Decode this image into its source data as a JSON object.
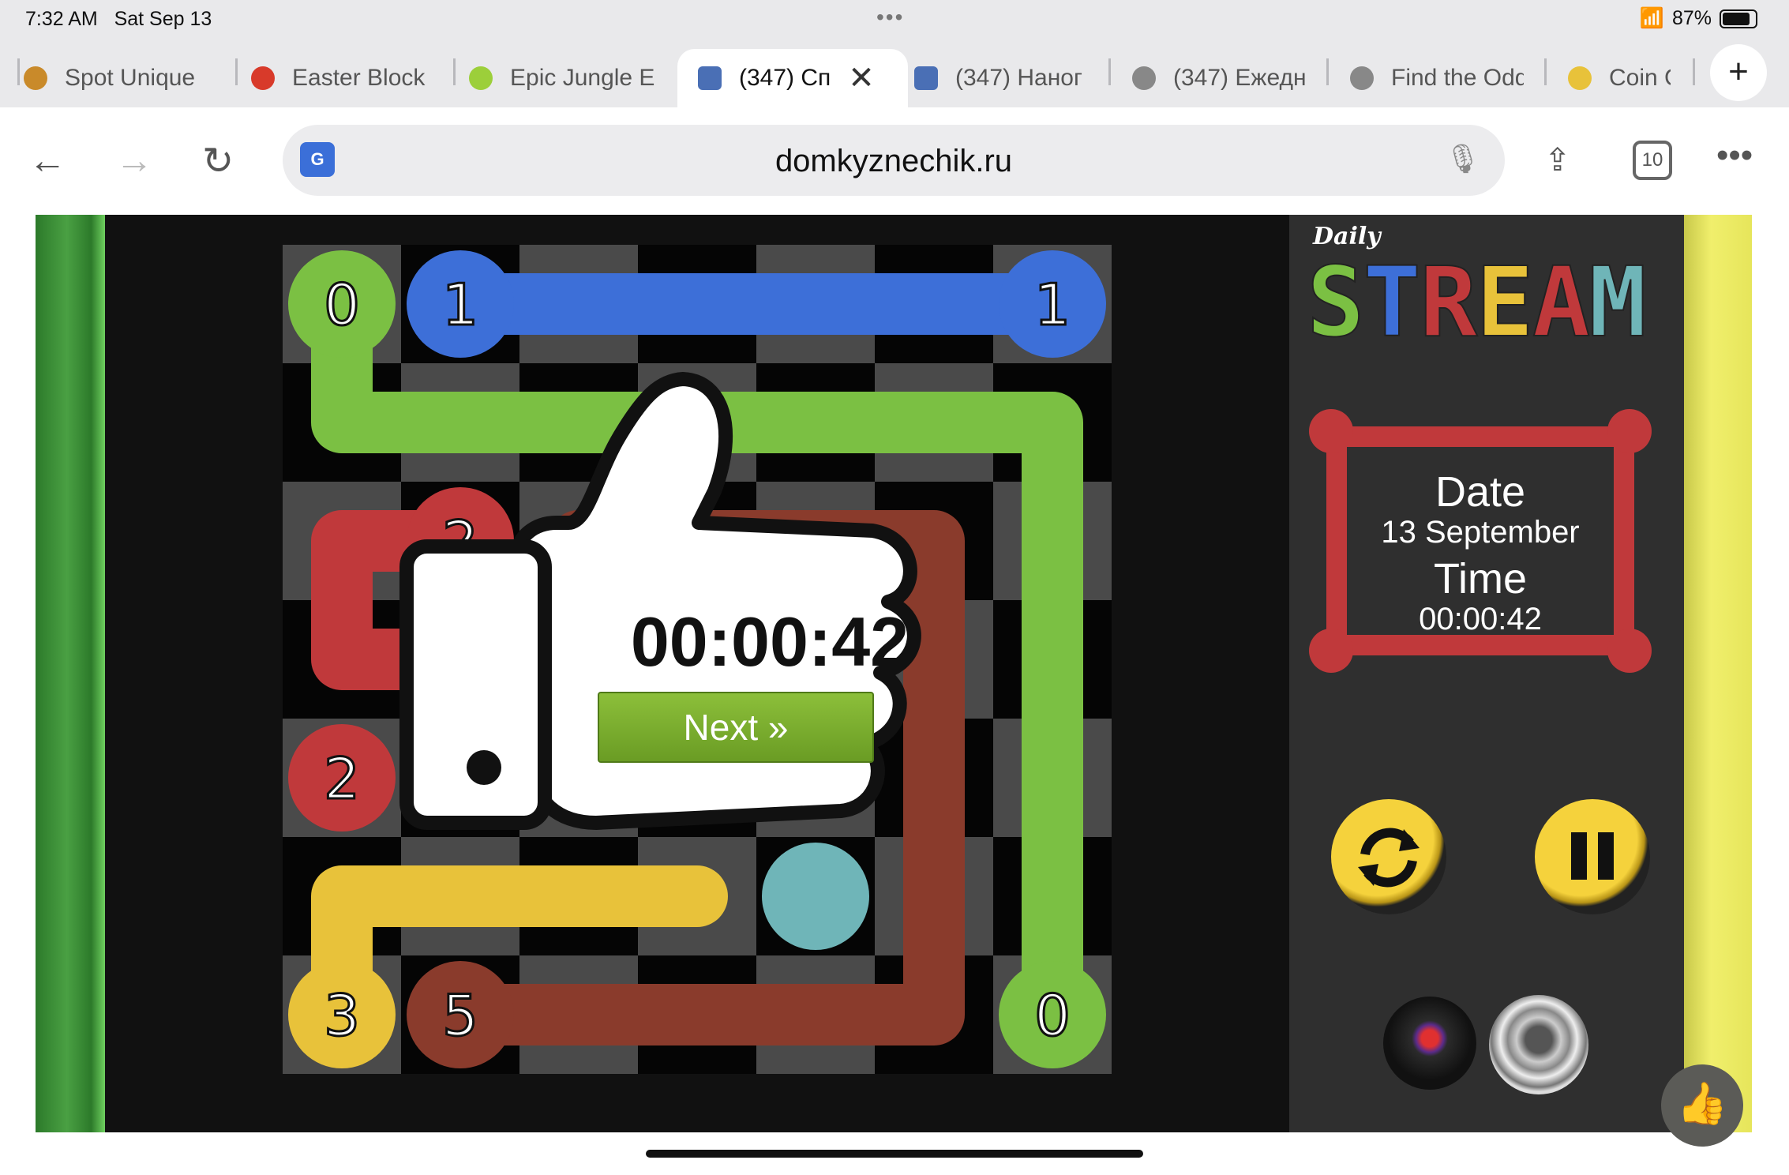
{
  "status_bar": {
    "time": "7:32 AM",
    "date": "Sat Sep 13",
    "dots": "•••",
    "battery": "87%"
  },
  "tabs": [
    {
      "label": "Spot Unique",
      "favicon_color": "#c98a2a"
    },
    {
      "label": "Easter Block",
      "favicon_color": "#d83a2a"
    },
    {
      "label": "Epic Jungle E",
      "favicon_color": "#9ccf3a"
    },
    {
      "label": "(347) Сп",
      "favicon_color": "#4a6fb5",
      "active": true
    },
    {
      "label": "(347) Наног",
      "favicon_color": "#4a6fb5"
    },
    {
      "label": "(347) Ежедн",
      "favicon_color": "#888888"
    },
    {
      "label": "Find the Odd",
      "favicon_color": "#888888"
    },
    {
      "label": "Coin C",
      "favicon_color": "#e8c23a"
    }
  ],
  "toolbar": {
    "url": "domkyznechik.ru",
    "tab_count": "10",
    "new_tab": "+",
    "close_tab": "✕",
    "translate_icon": "G"
  },
  "game": {
    "logo_daily": "Daily",
    "logo_letters": [
      {
        "ch": "S",
        "color": "#7bc043"
      },
      {
        "ch": "T",
        "color": "#3d6fd8"
      },
      {
        "ch": "R",
        "color": "#c0393b"
      },
      {
        "ch": "E",
        "color": "#e8c23a"
      },
      {
        "ch": "A",
        "color": "#c0393b"
      },
      {
        "ch": "M",
        "color": "#6fb5b8"
      }
    ],
    "date_label": "Date",
    "date_value": "13 September",
    "time_label": "Time",
    "time_value": "00:00:42",
    "popup_time": "00:00:42",
    "next_label": "Next »",
    "nodes": [
      {
        "label": "0",
        "color": "#7bc043"
      },
      {
        "label": "1",
        "color": "#3d6fd8"
      },
      {
        "label": "1",
        "color": "#3d6fd8"
      },
      {
        "label": "2",
        "color": "#c0393b"
      },
      {
        "label": "2",
        "color": "#c0393b"
      },
      {
        "label": "3",
        "color": "#e8c23a"
      },
      {
        "label": "5",
        "color": "#8a3b2c"
      },
      {
        "label": "0",
        "color": "#7bc043"
      }
    ]
  }
}
